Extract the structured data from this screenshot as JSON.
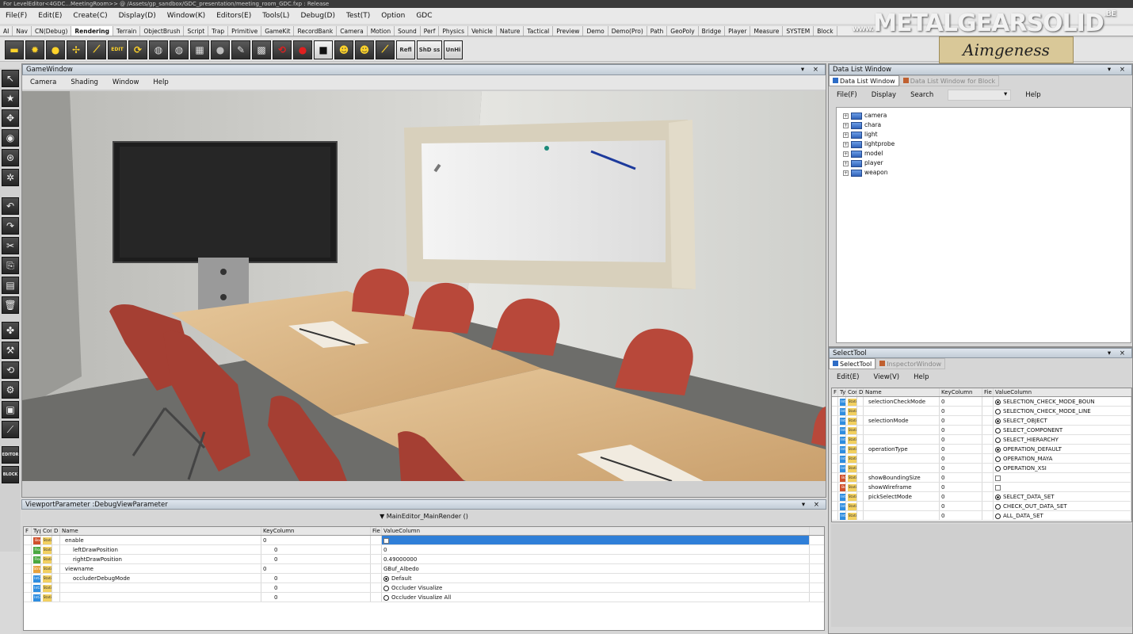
{
  "window": {
    "title": "For LevelEditor<4GDC...MeetingRoom>> @ /Assets/gp_sandbox/GDC_presentation/meeting_room_GDC.fxp : Release"
  },
  "menu": [
    "File(F)",
    "Edit(E)",
    "Create(C)",
    "Display(D)",
    "Window(K)",
    "Editors(E)",
    "Tools(L)",
    "Debug(D)",
    "Test(T)",
    "Option",
    "GDC"
  ],
  "tabs": [
    "AI",
    "Nav",
    "CN(Debug)",
    "Rendering",
    "Terrain",
    "ObjectBrush",
    "Script",
    "Trap",
    "Primitive",
    "GameKit",
    "RecordBank",
    "Camera",
    "Motion",
    "Sound",
    "Perf",
    "Physics",
    "Vehicle",
    "Nature",
    "Tactical",
    "Preview",
    "Demo",
    "Demo(Pro)",
    "Path",
    "GeoPoly",
    "Bridge",
    "Player",
    "Measure",
    "SYSTEM",
    "Block"
  ],
  "active_tab": "Rendering",
  "toolbar": {
    "edit_label": "EDIT",
    "refl_label": "Refl",
    "shadow_label": "ShD ss",
    "unhi_label": "UnHi"
  },
  "left_tools": {
    "editor_label": "EDITOR",
    "block_label": "BLOCK"
  },
  "game_window": {
    "title": "GameWindow",
    "menu": [
      "Camera",
      "Shading",
      "Window",
      "Help"
    ],
    "controls": "▾ ×"
  },
  "data_list": {
    "title": "Data List Window",
    "tabs": [
      "Data List Window",
      "Data List Window for Block"
    ],
    "menu": [
      "File(F)",
      "Display",
      "Search",
      "Help"
    ],
    "search_arrow": "▾",
    "items": [
      "camera",
      "chara",
      "light",
      "lightprobe",
      "model",
      "player",
      "weapon"
    ],
    "controls": "▾ ×"
  },
  "select_tool": {
    "title": "SelectTool",
    "tabs": [
      "SelectTool",
      "InspectorWindow"
    ],
    "menu": [
      "Edit(E)",
      "View(V)",
      "Help"
    ],
    "controls": "▾ ×",
    "headers": {
      "f": "F",
      "typ": "Typ",
      "con": "Con",
      "d": "D",
      "name": "Name",
      "key": "KeyColumn",
      "fie": "Fie",
      "value": "ValueColumn"
    },
    "rows": [
      {
        "type": "Int32",
        "con": "Static",
        "name": "selectionCheckMode",
        "key": "0",
        "value": "SELECTION_CHECK_MODE_BOUN",
        "radio": true,
        "on": true
      },
      {
        "type": "Int32",
        "con": "Static",
        "name": "",
        "key": "0",
        "value": "SELECTION_CHECK_MODE_LINE",
        "radio": true,
        "on": false
      },
      {
        "type": "Int32",
        "con": "Static",
        "name": "selectionMode",
        "key": "0",
        "value": "SELECT_OBJECT",
        "radio": true,
        "on": true
      },
      {
        "type": "Int32",
        "con": "Static",
        "name": "",
        "key": "0",
        "value": "SELECT_COMPONENT",
        "radio": true,
        "on": false
      },
      {
        "type": "Int32",
        "con": "Static",
        "name": "",
        "key": "0",
        "value": "SELECT_HIERARCHY",
        "radio": true,
        "on": false
      },
      {
        "type": "Int32",
        "con": "Static",
        "name": "operationType",
        "key": "0",
        "value": "OPERATION_DEFAULT",
        "radio": true,
        "on": true
      },
      {
        "type": "Int32",
        "con": "Static",
        "name": "",
        "key": "0",
        "value": "OPERATION_MAYA",
        "radio": true,
        "on": false
      },
      {
        "type": "Int32",
        "con": "Static",
        "name": "",
        "key": "0",
        "value": "OPERATION_XSI",
        "radio": true,
        "on": false
      },
      {
        "type": "Bool",
        "con": "Static",
        "name": "showBoundingSize",
        "key": "0",
        "value": "",
        "check": true
      },
      {
        "type": "Bool",
        "con": "Static",
        "name": "showWireframe",
        "key": "0",
        "value": "",
        "check": true
      },
      {
        "type": "Int32",
        "con": "Static",
        "name": "pickSelectMode",
        "key": "0",
        "value": "SELECT_DATA_SET",
        "radio": true,
        "on": true
      },
      {
        "type": "Int32",
        "con": "Static",
        "name": "",
        "key": "0",
        "value": "CHECK_OUT_DATA_SET",
        "radio": true,
        "on": false
      },
      {
        "type": "Int32",
        "con": "Static",
        "name": "",
        "key": "0",
        "value": "ALL_DATA_SET",
        "radio": true,
        "on": false
      }
    ]
  },
  "viewport_param": {
    "title": "ViewportParameter :DebugViewParameter",
    "render_label": "▼ MainEditor_MainRender ()",
    "controls": "▾ ×",
    "headers": {
      "f": "F",
      "typ": "Typ",
      "con": "Con",
      "d": "D",
      "name": "Name",
      "key": "KeyColumn",
      "fie": "Fie",
      "value": "ValueColumn"
    },
    "rows": [
      {
        "type": "Bool",
        "con": "Static",
        "name": "enable",
        "key": "0",
        "value": "",
        "check": true,
        "selected": true,
        "indent": false
      },
      {
        "type": "Float",
        "con": "Static",
        "name": "leftDrawPosition",
        "key": "0",
        "value": "0",
        "indent": true
      },
      {
        "type": "Float",
        "con": "Static",
        "name": "rightDrawPosition",
        "key": "0",
        "value": "0.49000000",
        "indent": true
      },
      {
        "type": "String",
        "con": "Static",
        "name": "viewname",
        "key": "0",
        "value": "GBuf_Albedo",
        "indent": false
      },
      {
        "type": "Int32",
        "con": "Static",
        "name": "occluderDebugMode",
        "key": "0",
        "value": "Default",
        "radio": true,
        "on": true,
        "indent": true
      },
      {
        "type": "Int32",
        "con": "Static",
        "name": "",
        "key": "0",
        "value": "Occluder Visualize",
        "radio": true,
        "on": false,
        "indent": true
      },
      {
        "type": "Int32",
        "con": "Static",
        "name": "",
        "key": "0",
        "value": "Occluder Visualize All",
        "radio": true,
        "on": false,
        "indent": true
      }
    ]
  },
  "watermark": {
    "prefix": "www.",
    "brand": "METALGEARSOLID",
    "suffix": ".BE",
    "tag": "Aimgeness"
  },
  "colors": {
    "accent_blue": "#2f7fd8",
    "panel_head": "#c8d2dc",
    "chair_red": "#b8483a",
    "table_wood": "#d9b88a"
  }
}
